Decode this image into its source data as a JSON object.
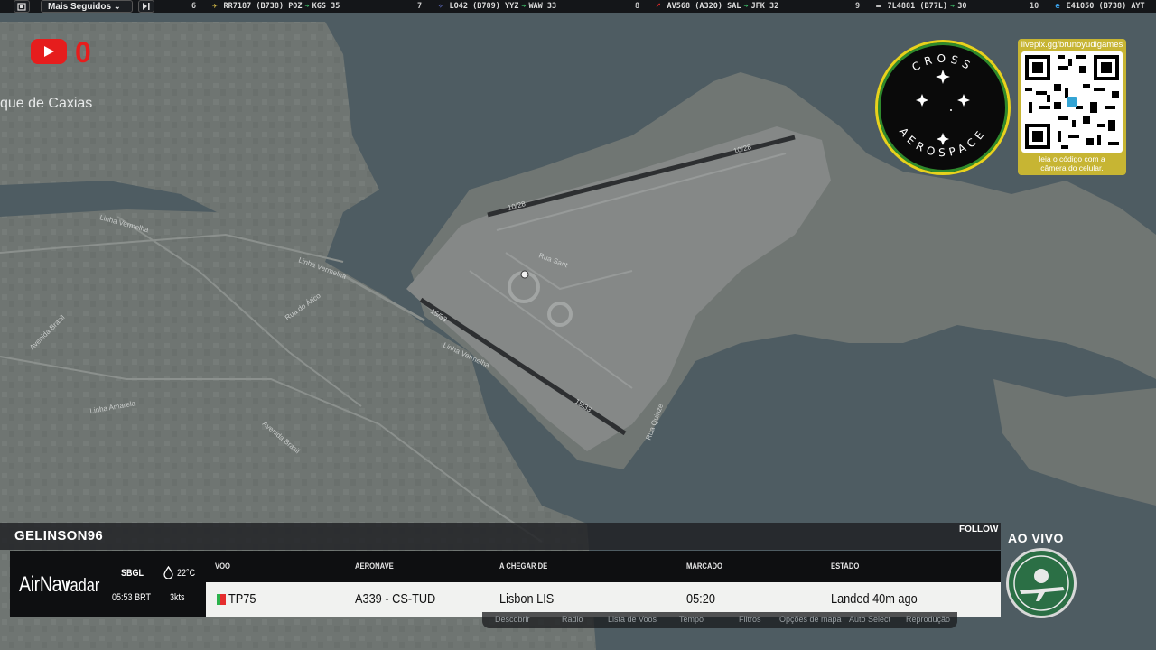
{
  "toolbar": {
    "menu_label": "Mais Seguidos",
    "menu_chevron": "chevron-down-icon",
    "left_icon": "square-icon",
    "skip_icon": "skip-icon"
  },
  "ticker": [
    {
      "rank": "6",
      "text": "RR7187 (B738) POZ",
      "dest": "KGS 35",
      "airline_icon": "eagle-icon"
    },
    {
      "rank": "7",
      "text": "LO42 (B789) YYZ",
      "dest": "WAW 33",
      "airline_icon": "lot-icon"
    },
    {
      "rank": "8",
      "text": "AV568 (A320) SAL",
      "dest": "JFK 32",
      "airline_icon": "avianca-icon"
    },
    {
      "rank": "9",
      "text": "7L4881 (B77L)",
      "dest": "30",
      "airline_icon": "plane-icon"
    },
    {
      "rank": "10",
      "text": "E41050 (B738) AYT",
      "dest": "",
      "airline_icon": "e-icon"
    }
  ],
  "map": {
    "city_label": "que de Caxias",
    "street_labels": [
      "Linha Vermelha",
      "Linha Vermelha",
      "Linha Vermelha",
      "Avenida Brasil",
      "Avenida Brasil",
      "Rua do Ático",
      "Linha Amarela",
      "Rua Sant",
      "Rua Quinze"
    ],
    "runway_labels": [
      "10/28",
      "10/28",
      "15/33",
      "15/33"
    ]
  },
  "youtube": {
    "count": "0",
    "icon": "youtube-icon"
  },
  "badge": {
    "top_text": "CROSS",
    "bottom_text": "AEROSPACE"
  },
  "qr": {
    "url": "livepix.gg/brunoyudigames",
    "caption_1": "leia o código com a",
    "caption_2": "câmera do celular."
  },
  "panel": {
    "username": "GELINSON96",
    "follow": "FOLLOW",
    "brand_1": "AirNav",
    "brand_2": "radar",
    "airport": "SBGL",
    "time": "05:53 BRT",
    "temp": "22°C",
    "wind": "3kts",
    "headers": {
      "flight": "VOO",
      "aircraft": "AERONAVE",
      "from": "A CHEGAR DE",
      "scheduled": "MARCADO",
      "status": "ESTADO"
    },
    "row": {
      "flight": "TP75",
      "aircraft": "A339 - CS-TUD",
      "from": "Lisbon LIS",
      "scheduled": "05:20",
      "status": "Landed 40m ago"
    },
    "menu": [
      "Descobrir",
      "Radio",
      "Lista de Voos",
      "Tempo",
      "Filtros",
      "Opções de mapa",
      "Auto Select",
      "Reprodução"
    ]
  },
  "live": {
    "label": "AO VIVO"
  },
  "colors": {
    "accent_red": "#e61d1d",
    "status_green": "#3fbf6a",
    "badge_yellow": "#e8d21c",
    "qr_gold": "#c7b533"
  }
}
